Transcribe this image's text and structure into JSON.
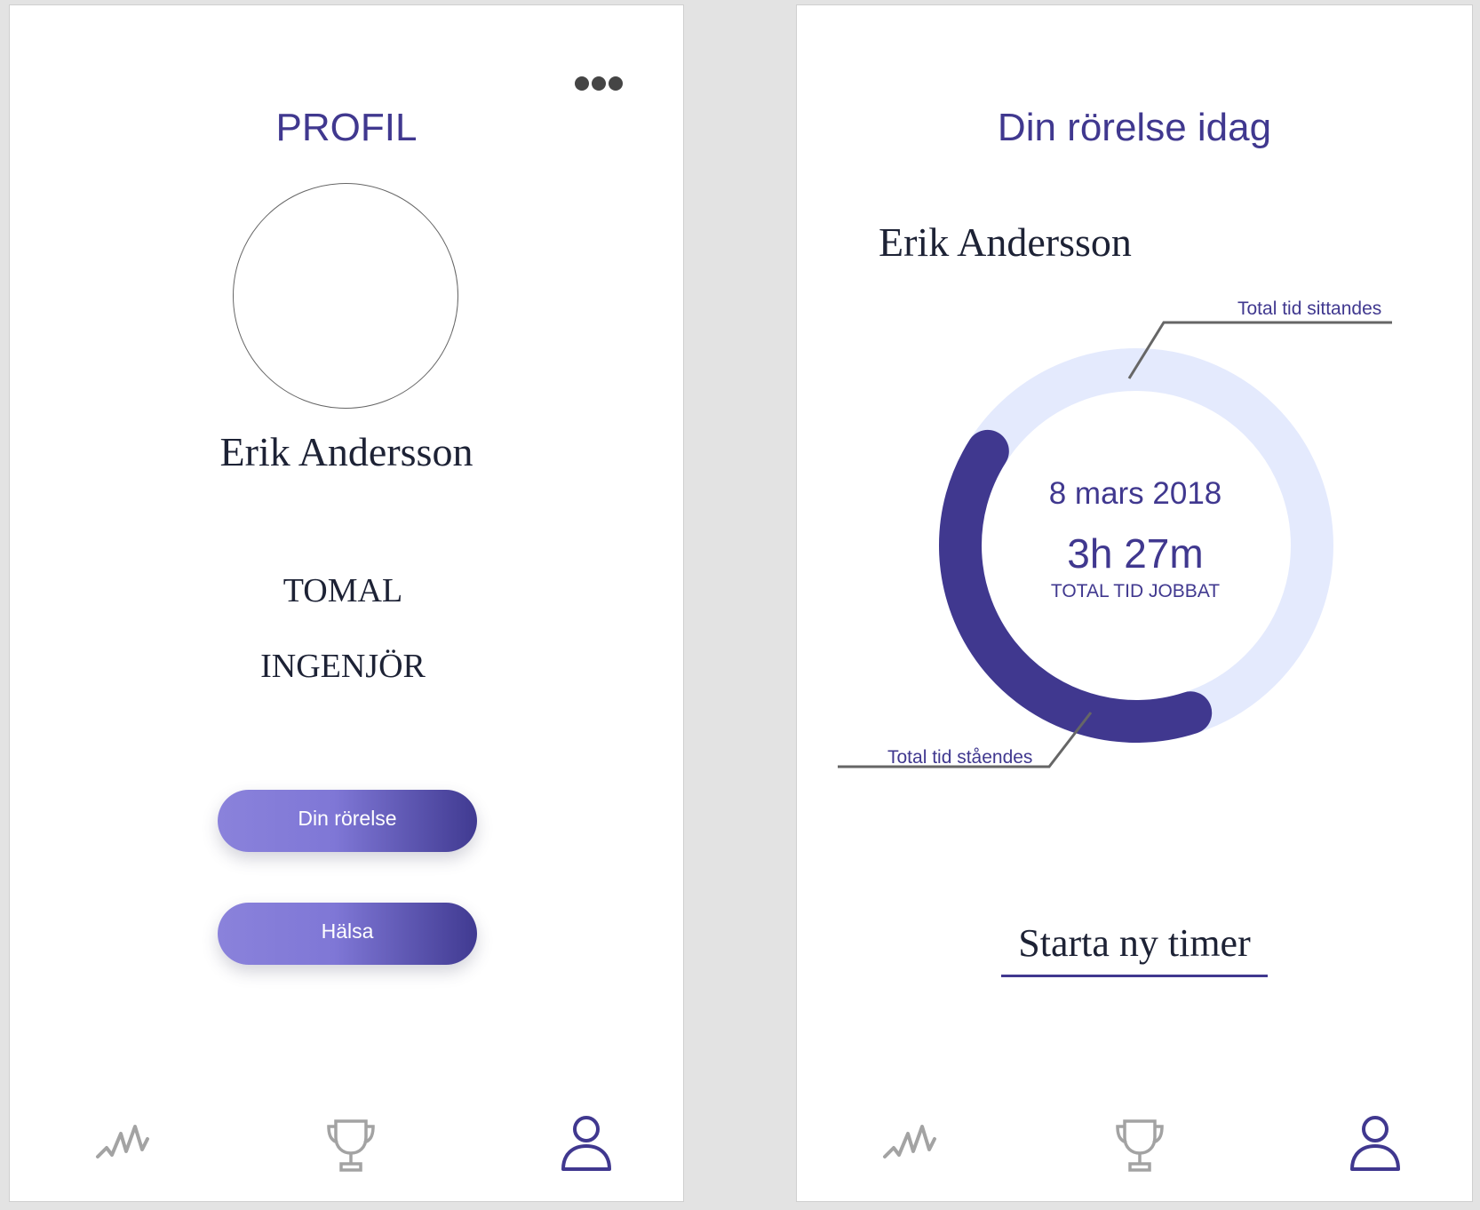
{
  "colors": {
    "accent": "#40388f",
    "donut_track": "#e4eafd",
    "icon_inactive": "#a3a3a3",
    "button_gradient_start": "#8a82db",
    "button_gradient_end": "#403a91"
  },
  "profile_screen": {
    "title": "PROFIL",
    "more_icon": "more-horizontal-icon",
    "user_name": "Erik Andersson",
    "role_line_1": "TOMAL",
    "role_line_2": "INGENJÖR",
    "buttons": [
      {
        "label": "Din rörelse"
      },
      {
        "label": "Hälsa"
      }
    ]
  },
  "movement_screen": {
    "title": "Din rörelse idag",
    "user_name": "Erik Andersson",
    "date": "8 mars 2018",
    "total_time": "3h 27m",
    "total_time_label": "TOTAL TID JOBBAT",
    "sitting_label": "Total tid sittandes",
    "standing_label": "Total tid ståendes",
    "standing_fraction": 0.39,
    "cta_label": "Starta ny timer"
  },
  "navbar": {
    "items": [
      {
        "icon": "activity-icon",
        "active": false
      },
      {
        "icon": "trophy-icon",
        "active": false
      },
      {
        "icon": "user-icon",
        "active": true
      }
    ]
  }
}
